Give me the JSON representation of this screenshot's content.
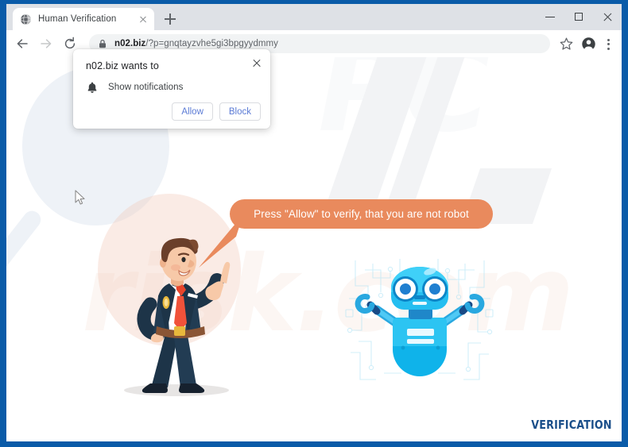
{
  "browser": {
    "window_controls": {
      "minimize": "minimize-button",
      "maximize": "maximize-button",
      "close": "close-button"
    },
    "tab": {
      "title": "Human Verification",
      "favicon": "globe-icon",
      "close_label": "close-tab-icon"
    },
    "new_tab_label": "new-tab-button",
    "navigation": {
      "back": "back-icon",
      "forward": "forward-icon",
      "reload": "reload-icon"
    },
    "omnibox": {
      "security_icon": "lock-icon",
      "url_domain": "n02.biz",
      "url_path": "/?p=gnqtayzvhe5gi3bpgyydmmy",
      "url_full": "n02.biz/?p=gnqtayzvhe5gi3bpgyydmmy"
    },
    "toolbar_icons": {
      "bookmark": "star-icon",
      "profile": "account-avatar-icon",
      "menu": "three-dot-menu-icon"
    }
  },
  "permission_dialog": {
    "title": "n02.biz wants to",
    "permission_icon": "bell-icon",
    "permission_label": "Show notifications",
    "allow_label": "Allow",
    "block_label": "Block",
    "close_label": "close-dialog-icon"
  },
  "page": {
    "bubble_text": "Press \"Allow\" to verify, that you are not robot",
    "verification_label": "VERIFICATION",
    "watermark_top": "PC",
    "watermark_bottom": "risk.com",
    "man_illustration": "pointing-businessman-illustration",
    "robot_illustration": "robot-illustration",
    "magnifier_illustration": "magnifying-glass-background"
  },
  "colors": {
    "frame_blue": "#0a5ba8",
    "bubble_orange": "#e98a5d",
    "verification_blue": "#1b4f8a",
    "tabstrip_gray": "#dee1e6",
    "omnibox_gray": "#f1f3f4",
    "button_blue": "#5b7bd5",
    "robot_cyan": "#29c5f6"
  }
}
